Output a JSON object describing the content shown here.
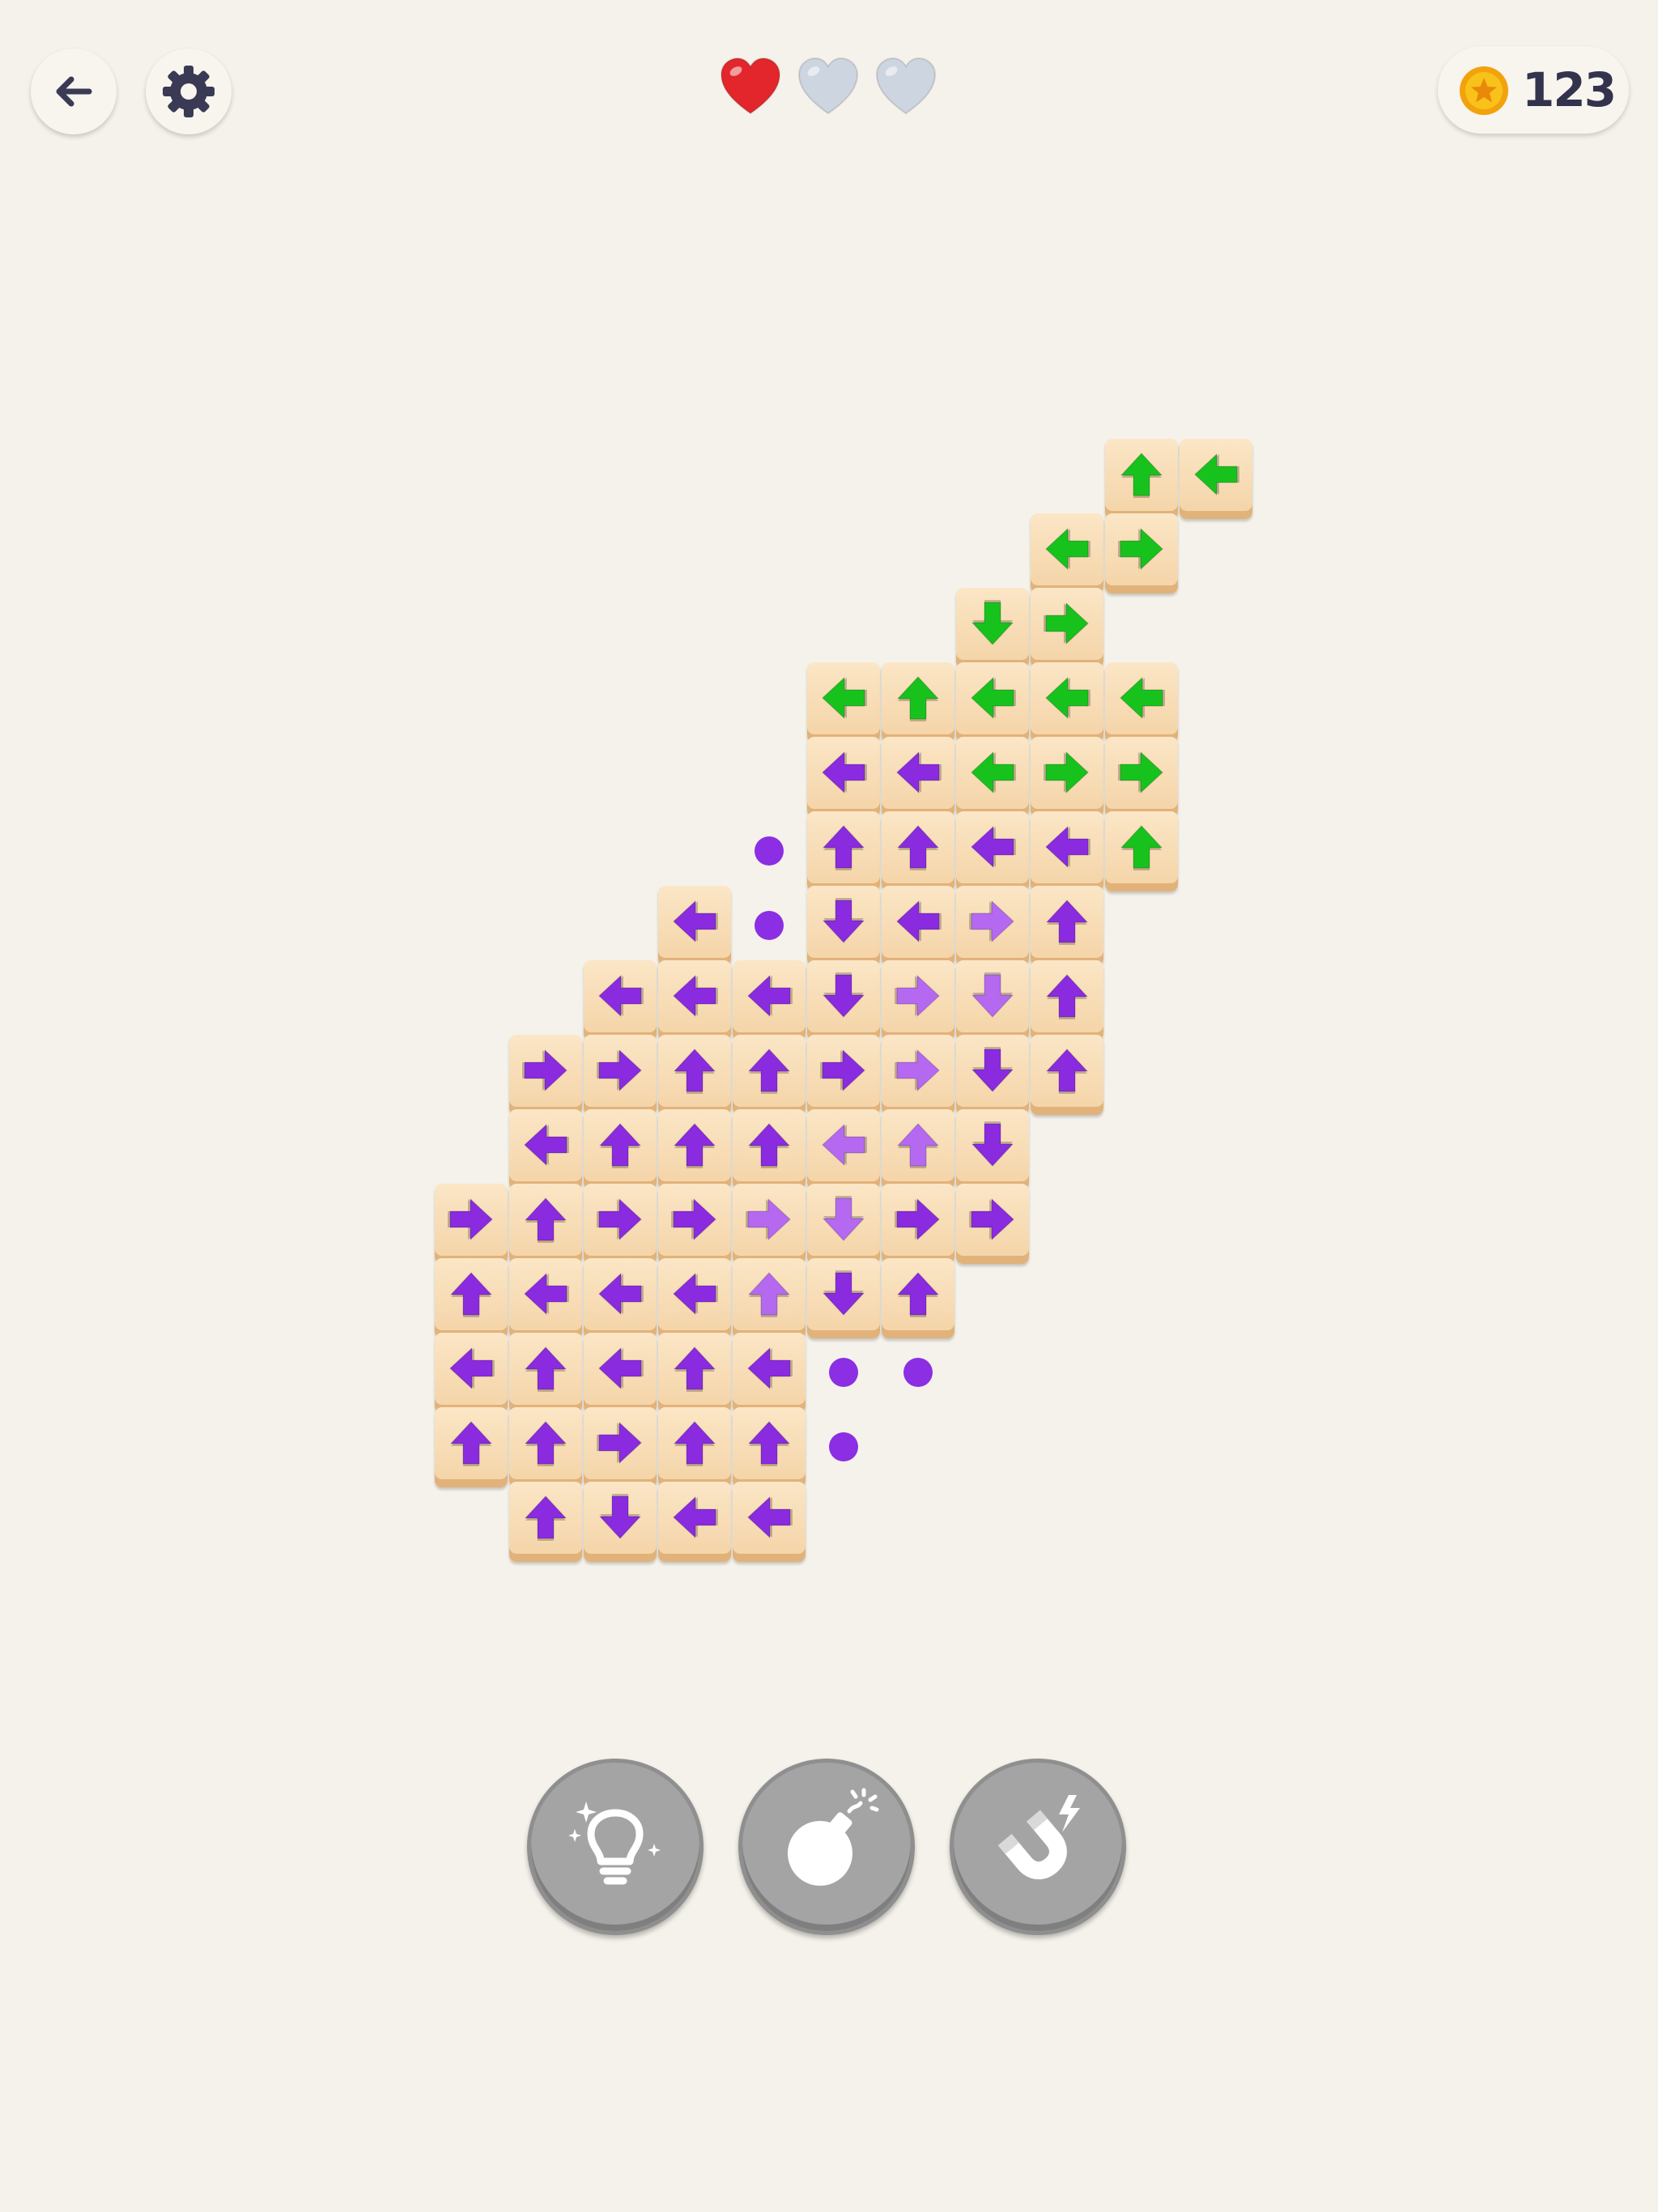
{
  "header": {
    "back_icon": "arrow-left-icon",
    "settings_icon": "gear-icon",
    "lives": {
      "filled": 1,
      "total": 3,
      "filled_color": "#e3262b",
      "empty_color": "#cdd5e1"
    },
    "coins": {
      "icon": "coin-icon",
      "count": "123"
    }
  },
  "colors": {
    "background": "#f4f2ea",
    "tile": "#f6d8b0",
    "arrow_purple": "#8a2be0",
    "arrow_purple_light": "#b569f0",
    "arrow_green": "#18c21d",
    "dot": "#8b2ee4",
    "powerup_gray": "#a4a4a4"
  },
  "grid": {
    "rows": [
      {
        "row": 0,
        "cells": [
          [
            9,
            "up",
            "green"
          ],
          [
            10,
            "left",
            "green"
          ]
        ]
      },
      {
        "row": 1,
        "cells": [
          [
            8,
            "left",
            "green"
          ],
          [
            9,
            "right",
            "green"
          ]
        ]
      },
      {
        "row": 2,
        "cells": [
          [
            7,
            "down",
            "green"
          ],
          [
            8,
            "right",
            "green"
          ]
        ]
      },
      {
        "row": 3,
        "cells": [
          [
            5,
            "left",
            "green"
          ],
          [
            6,
            "up",
            "green"
          ],
          [
            7,
            "left",
            "green"
          ],
          [
            8,
            "left",
            "green"
          ],
          [
            9,
            "left",
            "green"
          ]
        ]
      },
      {
        "row": 4,
        "cells": [
          [
            5,
            "left",
            "purple"
          ],
          [
            6,
            "left",
            "purple"
          ],
          [
            7,
            "left",
            "green"
          ],
          [
            8,
            "right",
            "green"
          ],
          [
            9,
            "right",
            "green"
          ]
        ]
      },
      {
        "row": 5,
        "cells": [
          [
            5,
            "up",
            "purple"
          ],
          [
            6,
            "up",
            "purple"
          ],
          [
            7,
            "left",
            "purple"
          ],
          [
            8,
            "left",
            "purple"
          ],
          [
            9,
            "up",
            "green"
          ]
        ]
      },
      {
        "row": 6,
        "cells": [
          [
            3,
            "left",
            "purple"
          ],
          [
            5,
            "down",
            "purple"
          ],
          [
            6,
            "left",
            "purple"
          ],
          [
            7,
            "right",
            "light"
          ],
          [
            8,
            "up",
            "purple"
          ]
        ]
      },
      {
        "row": 7,
        "cells": [
          [
            2,
            "left",
            "purple"
          ],
          [
            3,
            "left",
            "purple"
          ],
          [
            4,
            "left",
            "purple"
          ],
          [
            5,
            "down",
            "purple"
          ],
          [
            6,
            "right",
            "light"
          ],
          [
            7,
            "down",
            "light"
          ],
          [
            8,
            "up",
            "purple"
          ]
        ]
      },
      {
        "row": 8,
        "cells": [
          [
            1,
            "right",
            "purple"
          ],
          [
            2,
            "right",
            "purple"
          ],
          [
            3,
            "up",
            "purple"
          ],
          [
            4,
            "up",
            "purple"
          ],
          [
            5,
            "right",
            "purple"
          ],
          [
            6,
            "right",
            "light"
          ],
          [
            7,
            "down",
            "purple"
          ],
          [
            8,
            "up",
            "purple"
          ]
        ]
      },
      {
        "row": 9,
        "cells": [
          [
            1,
            "left",
            "purple"
          ],
          [
            2,
            "up",
            "purple"
          ],
          [
            3,
            "up",
            "purple"
          ],
          [
            4,
            "up",
            "purple"
          ],
          [
            5,
            "left",
            "light"
          ],
          [
            6,
            "up",
            "light"
          ],
          [
            7,
            "down",
            "purple"
          ]
        ]
      },
      {
        "row": 10,
        "cells": [
          [
            0,
            "right",
            "purple"
          ],
          [
            1,
            "up",
            "purple"
          ],
          [
            2,
            "right",
            "purple"
          ],
          [
            3,
            "right",
            "purple"
          ],
          [
            4,
            "right",
            "light"
          ],
          [
            5,
            "down",
            "light"
          ],
          [
            6,
            "right",
            "purple"
          ],
          [
            7,
            "right",
            "purple"
          ]
        ]
      },
      {
        "row": 11,
        "cells": [
          [
            0,
            "up",
            "purple"
          ],
          [
            1,
            "left",
            "purple"
          ],
          [
            2,
            "left",
            "purple"
          ],
          [
            3,
            "left",
            "purple"
          ],
          [
            4,
            "up",
            "light"
          ],
          [
            5,
            "down",
            "purple"
          ],
          [
            6,
            "up",
            "purple"
          ]
        ]
      },
      {
        "row": 12,
        "cells": [
          [
            0,
            "left",
            "purple"
          ],
          [
            1,
            "up",
            "purple"
          ],
          [
            2,
            "left",
            "purple"
          ],
          [
            3,
            "up",
            "purple"
          ],
          [
            4,
            "left",
            "purple"
          ]
        ]
      },
      {
        "row": 13,
        "cells": [
          [
            0,
            "up",
            "purple"
          ],
          [
            1,
            "up",
            "purple"
          ],
          [
            2,
            "right",
            "purple"
          ],
          [
            3,
            "up",
            "purple"
          ],
          [
            4,
            "up",
            "purple"
          ]
        ]
      },
      {
        "row": 14,
        "cells": [
          [
            1,
            "up",
            "purple"
          ],
          [
            2,
            "down",
            "purple"
          ],
          [
            3,
            "left",
            "purple"
          ],
          [
            4,
            "left",
            "purple"
          ]
        ]
      }
    ],
    "dots": [
      [
        5,
        4
      ],
      [
        6,
        4
      ],
      [
        12,
        5
      ],
      [
        12,
        6
      ],
      [
        13,
        5
      ]
    ]
  },
  "powerups": [
    {
      "name": "hint",
      "icon": "lightbulb-icon"
    },
    {
      "name": "bomb",
      "icon": "bomb-icon"
    },
    {
      "name": "magnet",
      "icon": "magnet-icon"
    }
  ]
}
